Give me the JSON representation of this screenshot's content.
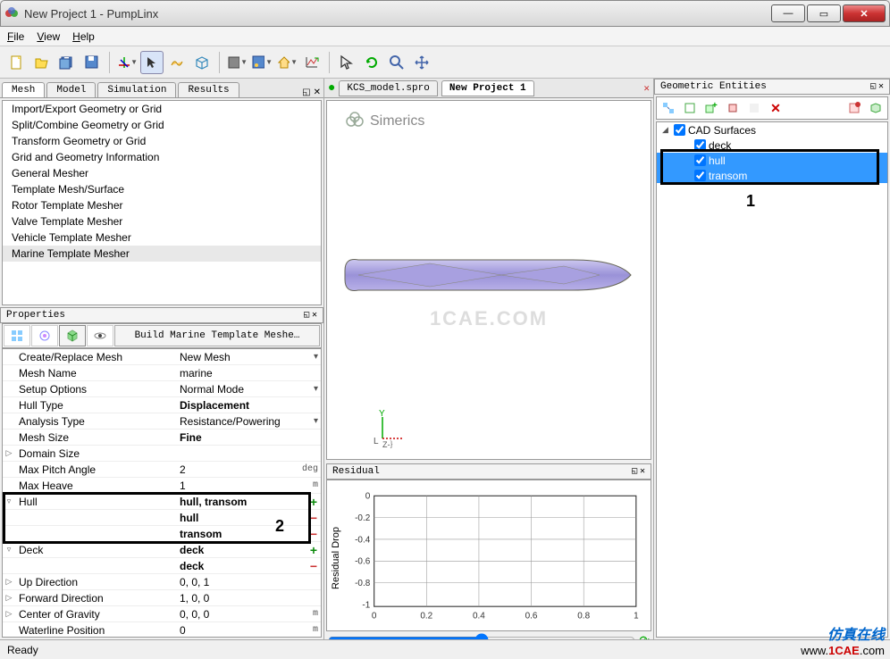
{
  "window": {
    "title": "New Project 1 - PumpLinx"
  },
  "menu": {
    "file": "File",
    "view": "View",
    "help": "Help"
  },
  "left_tabs": {
    "mesh": "Mesh",
    "model": "Model",
    "simulation": "Simulation",
    "results": "Results"
  },
  "mesh_items": [
    "Import/Export Geometry or Grid",
    "Split/Combine Geometry or Grid",
    "Transform Geometry or Grid",
    "Grid and Geometry Information",
    "General Mesher",
    "Template Mesh/Surface",
    "Rotor Template Mesher",
    "Valve Template Mesher",
    "Vehicle Template Mesher",
    "Marine Template Mesher"
  ],
  "properties_title": "Properties",
  "build_button": "Build Marine Template Meshe…",
  "props": {
    "create_replace": {
      "label": "Create/Replace Mesh",
      "value": "New Mesh"
    },
    "mesh_name": {
      "label": "Mesh Name",
      "value": "marine"
    },
    "setup_options": {
      "label": "Setup Options",
      "value": "Normal Mode"
    },
    "hull_type": {
      "label": "Hull Type",
      "value": "Displacement"
    },
    "analysis_type": {
      "label": "Analysis Type",
      "value": "Resistance/Powering"
    },
    "mesh_size": {
      "label": "Mesh Size",
      "value": "Fine"
    },
    "domain_size": {
      "label": "Domain Size",
      "value": ""
    },
    "max_pitch": {
      "label": "Max Pitch Angle",
      "value": "2",
      "unit": "deg"
    },
    "max_heave": {
      "label": "Max Heave",
      "value": "1",
      "unit": "m"
    },
    "hull": {
      "label": "Hull",
      "value": "hull, transom"
    },
    "hull_sub1": {
      "value": "hull"
    },
    "hull_sub2": {
      "value": "transom"
    },
    "deck": {
      "label": "Deck",
      "value": "deck"
    },
    "deck_sub1": {
      "value": "deck"
    },
    "up_dir": {
      "label": "Up Direction",
      "value": "0, 0, 1"
    },
    "fwd_dir": {
      "label": "Forward Direction",
      "value": "1, 0, 0"
    },
    "cog": {
      "label": "Center of Gravity",
      "value": "0, 0, 0",
      "unit": "m"
    },
    "waterline": {
      "label": "Waterline Position",
      "value": "0",
      "unit": "m"
    }
  },
  "file_tabs": {
    "t1": "KCS_model.spro",
    "t2": "New Project 1"
  },
  "viewport": {
    "brand": "Simerics",
    "watermark": "1CAE.COM"
  },
  "residual": {
    "title": "Residual",
    "ylabel": "Residual Drop",
    "yticks": [
      "0",
      "-0.2",
      "-0.4",
      "-0.6",
      "-0.8",
      "-1"
    ],
    "xticks": [
      "0",
      "0.2",
      "0.4",
      "0.6",
      "0.8",
      "1"
    ]
  },
  "geo": {
    "title": "Geometric Entities",
    "root": "CAD Surfaces",
    "items": [
      {
        "name": "deck",
        "selected": false
      },
      {
        "name": "hull",
        "selected": true
      },
      {
        "name": "transom",
        "selected": true
      }
    ]
  },
  "status": "Ready",
  "annotations": {
    "a1": "1",
    "a2": "2"
  },
  "footer": {
    "cn": "仿真在线",
    "url_pre": "www.",
    "url_mid": "1CAE",
    "url_post": ".com"
  },
  "chart_data": {
    "type": "line",
    "title": "Residual",
    "xlabel": "",
    "ylabel": "Residual Drop",
    "xlim": [
      0,
      1
    ],
    "ylim": [
      -1,
      0
    ],
    "series": []
  }
}
